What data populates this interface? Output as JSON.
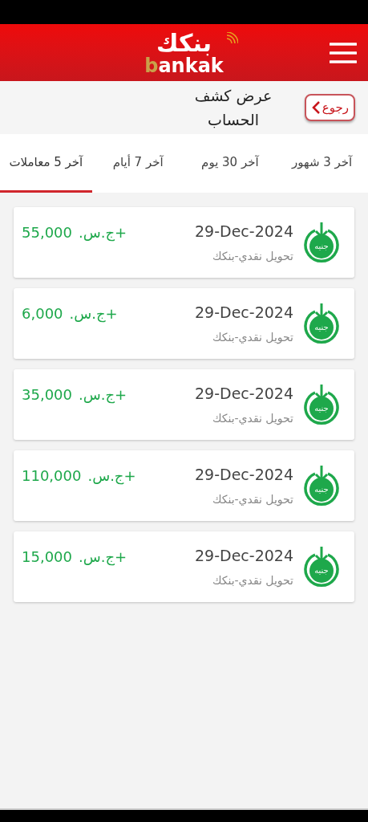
{
  "header": {
    "logo_arabic": "بنكك",
    "logo_latin_first": "b",
    "logo_latin_rest": "ankak"
  },
  "subheader": {
    "back_label": "رجوع",
    "title": "عرض كشف الحساب"
  },
  "tabs": [
    {
      "label": "آخر 3 شهور",
      "selected": false
    },
    {
      "label": "آخر 30 يوم",
      "selected": false
    },
    {
      "label": "آخر 7 أيام",
      "selected": false
    },
    {
      "label": "آخر 5 معاملات",
      "selected": true
    }
  ],
  "transactions": [
    {
      "badge": "جنيه",
      "date": "29-Dec-2024",
      "description": "تحويل نقدي-بنكك",
      "currency": "+ج.س.",
      "amount": "55,000"
    },
    {
      "badge": "جنيه",
      "date": "29-Dec-2024",
      "description": "تحويل نقدي-بنكك",
      "currency": "+ج.س.",
      "amount": "6,000"
    },
    {
      "badge": "جنيه",
      "date": "29-Dec-2024",
      "description": "تحويل نقدي-بنكك",
      "currency": "+ج.س.",
      "amount": "35,000"
    },
    {
      "badge": "جنيه",
      "date": "29-Dec-2024",
      "description": "تحويل نقدي-بنكك",
      "currency": "+ج.س.",
      "amount": "110,000"
    },
    {
      "badge": "جنيه",
      "date": "29-Dec-2024",
      "description": "تحويل نقدي-بنكك",
      "currency": "+ج.س.",
      "amount": "15,000"
    }
  ]
}
